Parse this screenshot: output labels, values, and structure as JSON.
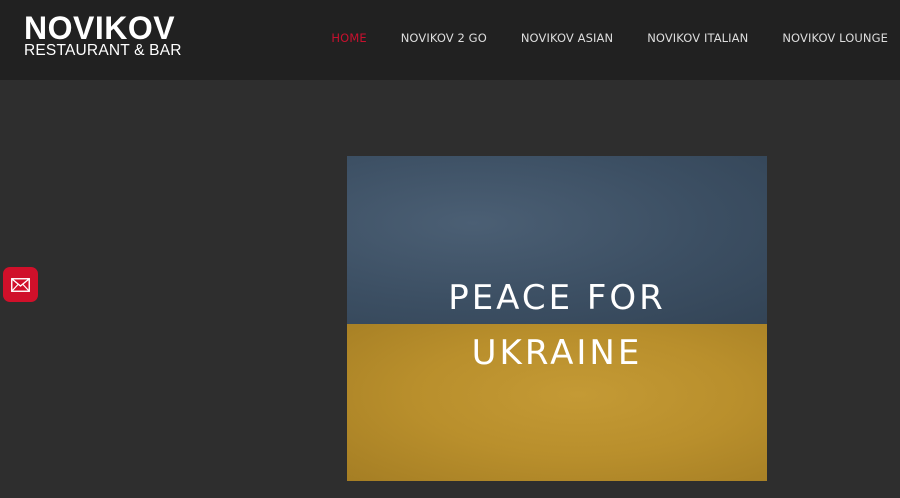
{
  "header": {
    "logo": {
      "name": "NOVIKOV",
      "tagline": "RESTAURANT & BAR"
    },
    "nav": [
      {
        "label": "HOME",
        "active": true
      },
      {
        "label": "NOVIKOV 2 GO",
        "active": false
      },
      {
        "label": "NOVIKOV ASIAN",
        "active": false
      },
      {
        "label": "NOVIKOV ITALIAN",
        "active": false
      },
      {
        "label": "NOVIKOV LOUNGE",
        "active": false
      }
    ]
  },
  "contact_button": {
    "icon": "envelope-icon"
  },
  "banner": {
    "line1": "PEACE FOR",
    "line2": "UKRAINE"
  },
  "colors": {
    "accent": "#c8102e",
    "header_bg": "#212121",
    "page_bg": "#2e2e2e",
    "flag_blue": "#3c4f63",
    "flag_yellow": "#b98f2c"
  }
}
